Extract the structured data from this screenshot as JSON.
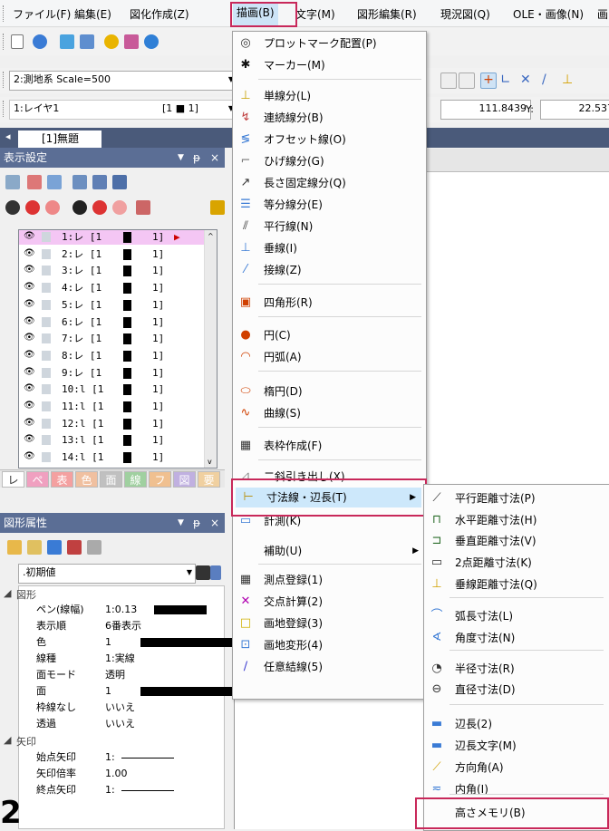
{
  "menubar": {
    "items": [
      {
        "label": "ファイル(F)"
      },
      {
        "label": "編集(E)"
      },
      {
        "label": "図化作成(Z)"
      },
      {
        "label": "描画(B)"
      },
      {
        "label": "文字(M)"
      },
      {
        "label": "図形編集(R)"
      },
      {
        "label": "現況図(Q)"
      },
      {
        "label": "OLE・画像(N)"
      },
      {
        "label": "画"
      }
    ]
  },
  "toolbar": {
    "scale_combo": "2:測地系 Scale=500",
    "layer_combo": "1:レイヤ1",
    "layer_range": "[1 ■ 1]",
    "coord_x": "111.8439",
    "coord_y_label": "Y:",
    "coord_y": "22.537"
  },
  "doc_tab": {
    "label": "[1]無題"
  },
  "display_panel": {
    "title": "表示設定",
    "layers": [
      {
        "name": "1:レ [1",
        "end": "1]"
      },
      {
        "name": "2:レ [1",
        "end": "1]"
      },
      {
        "name": "3:レ [1",
        "end": "1]"
      },
      {
        "name": "4:レ [1",
        "end": "1]"
      },
      {
        "name": "5:レ [1",
        "end": "1]"
      },
      {
        "name": "6:レ [1",
        "end": "1]"
      },
      {
        "name": "7:レ [1",
        "end": "1]"
      },
      {
        "name": "8:レ [1",
        "end": "1]"
      },
      {
        "name": "9:レ [1",
        "end": "1]"
      },
      {
        "name": "10:l [1",
        "end": "1]"
      },
      {
        "name": "11:l [1",
        "end": "1]"
      },
      {
        "name": "12:l [1",
        "end": "1]"
      },
      {
        "name": "13:l [1",
        "end": "1]"
      },
      {
        "name": "14:l [1",
        "end": "1]"
      }
    ],
    "tabs": [
      "レ",
      "ペ",
      "表",
      "色",
      "面",
      "線",
      "フ",
      "図",
      "要"
    ]
  },
  "attr_panel": {
    "title": "図形属性",
    "combo": ".初期値",
    "group_shape": "図形",
    "rows": [
      {
        "k": "ペン(線幅)",
        "v": "1:0.13"
      },
      {
        "k": "表示順",
        "v": "6番表示"
      },
      {
        "k": "色",
        "v": "1"
      },
      {
        "k": "線種",
        "v": "1:実線"
      },
      {
        "k": "面モード",
        "v": "透明"
      },
      {
        "k": "面",
        "v": "1"
      },
      {
        "k": "枠線なし",
        "v": "いいえ"
      },
      {
        "k": "透過",
        "v": "いいえ"
      }
    ],
    "group_arrow": "矢印",
    "arrow_rows": [
      {
        "k": "始点矢印",
        "v": "1:"
      },
      {
        "k": "矢印倍率",
        "v": "1.00"
      },
      {
        "k": "終点矢印",
        "v": "1:"
      }
    ]
  },
  "draw_menu": {
    "items": [
      {
        "label": "プロットマーク配置(P)",
        "icon": "target-icon"
      },
      {
        "label": "マーカー(M)",
        "icon": "asterisk-icon"
      },
      {
        "label": "単線分(L)",
        "icon": "line-icon"
      },
      {
        "label": "連続線分(B)",
        "icon": "polyline-icon"
      },
      {
        "label": "オフセット線(O)",
        "icon": "offset-icon"
      },
      {
        "label": "ひげ線分(G)",
        "icon": "whisker-icon"
      },
      {
        "label": "長さ固定線分(Q)",
        "icon": "fixed-line-icon"
      },
      {
        "label": "等分線分(E)",
        "icon": "divide-icon"
      },
      {
        "label": "平行線(N)",
        "icon": "parallel-icon"
      },
      {
        "label": "垂線(I)",
        "icon": "perpendicular-icon"
      },
      {
        "label": "接線(Z)",
        "icon": "tangent-icon"
      },
      {
        "label": "四角形(R)",
        "icon": "rectangle-icon"
      },
      {
        "label": "円(C)",
        "icon": "circle-icon"
      },
      {
        "label": "円弧(A)",
        "icon": "arc-icon"
      },
      {
        "label": "楕円(D)",
        "icon": "ellipse-icon"
      },
      {
        "label": "曲線(S)",
        "icon": "curve-icon"
      },
      {
        "label": "表枠作成(F)",
        "icon": "table-icon"
      },
      {
        "label": "二斜引き出し(X)",
        "icon": "leader-icon"
      },
      {
        "label": "寸法線・辺長(T)",
        "icon": "dimension-icon"
      },
      {
        "label": "計測(K)",
        "icon": "measure-icon"
      },
      {
        "label": "補助(U)",
        "icon": ""
      },
      {
        "label": "測点登録(1)",
        "icon": "point-icon"
      },
      {
        "label": "交点計算(2)",
        "icon": "intersection-icon"
      },
      {
        "label": "画地登録(3)",
        "icon": "lot-icon"
      },
      {
        "label": "画地変形(4)",
        "icon": "lot-transform-icon"
      },
      {
        "label": "任意結線(5)",
        "icon": "connect-icon"
      }
    ]
  },
  "dim_submenu": {
    "items": [
      {
        "label": "平行距離寸法(P)"
      },
      {
        "label": "水平距離寸法(H)"
      },
      {
        "label": "垂直距離寸法(V)"
      },
      {
        "label": "2点距離寸法(K)"
      },
      {
        "label": "垂線距離寸法(Q)"
      },
      {
        "label": "弧長寸法(L)"
      },
      {
        "label": "角度寸法(N)"
      },
      {
        "label": "半径寸法(R)"
      },
      {
        "label": "直径寸法(D)"
      },
      {
        "label": "辺長(2)"
      },
      {
        "label": "辺長文字(M)"
      },
      {
        "label": "方向角(A)"
      },
      {
        "label": "内角(I)"
      },
      {
        "label": "高さメモリ(B)"
      }
    ]
  },
  "colors": {
    "panel_header": "#5b6e95",
    "highlight": "#c8285a",
    "layer_selected": "#f4c6f4"
  }
}
